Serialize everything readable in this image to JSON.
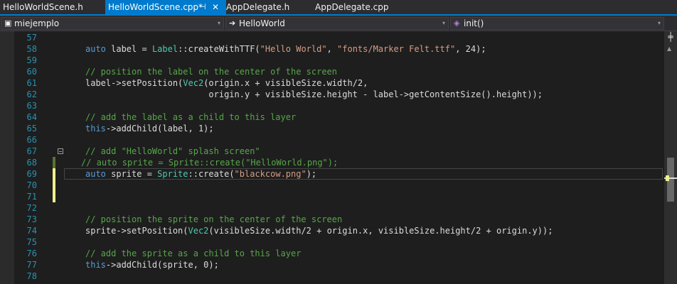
{
  "tabs": [
    {
      "label": "HelloWorldScene.h",
      "active": false
    },
    {
      "label": "HelloWorldScene.cpp*",
      "active": true
    },
    {
      "label": "AppDelegate.h",
      "active": false
    },
    {
      "label": "AppDelegate.cpp",
      "active": false
    }
  ],
  "icons": {
    "pin": "⊣",
    "close": "✕",
    "dropdown": "▾"
  },
  "navigation": {
    "project": "miejemplo",
    "scope": "HelloWorld",
    "member": "init()"
  },
  "code_lines": [
    {
      "num": "57",
      "tokens": []
    },
    {
      "num": "58",
      "tokens": [
        [
          "kw",
          "auto"
        ],
        [
          "pl",
          " label = "
        ],
        [
          "ty",
          "Label"
        ],
        [
          "pl",
          "::createWithTTF("
        ],
        [
          "str",
          "\"Hello World\""
        ],
        [
          "pl",
          ", "
        ],
        [
          "str",
          "\"fonts/Marker Felt.ttf\""
        ],
        [
          "pl",
          ", 24);"
        ]
      ]
    },
    {
      "num": "59",
      "tokens": []
    },
    {
      "num": "60",
      "tokens": [
        [
          "cm",
          "// position the label on the center of the screen"
        ]
      ]
    },
    {
      "num": "61",
      "tokens": [
        [
          "pl",
          "label->setPosition("
        ],
        [
          "ty",
          "Vec2"
        ],
        [
          "pl",
          "(origin.x + visibleSize.width/2,"
        ]
      ]
    },
    {
      "num": "62",
      "tokens": [
        [
          "pl",
          "                        origin.y + visibleSize.height - label->getContentSize().height));"
        ]
      ]
    },
    {
      "num": "63",
      "tokens": []
    },
    {
      "num": "64",
      "tokens": [
        [
          "cm",
          "// add the label as a child to this layer"
        ]
      ]
    },
    {
      "num": "65",
      "tokens": [
        [
          "kw",
          "this"
        ],
        [
          "pl",
          "->addChild(label, 1);"
        ]
      ]
    },
    {
      "num": "66",
      "tokens": []
    },
    {
      "num": "67",
      "tokens": [
        [
          "cm",
          "// add \"HelloWorld\" splash screen\""
        ]
      ]
    },
    {
      "num": "68",
      "tokens": [
        [
          "cm",
          "// auto sprite = Sprite::create(\"HelloWorld.png\");"
        ]
      ]
    },
    {
      "num": "69",
      "tokens": [
        [
          "kw",
          "auto"
        ],
        [
          "pl",
          " sprite = "
        ],
        [
          "ty",
          "Sprite"
        ],
        [
          "pl",
          "::create("
        ],
        [
          "str",
          "\"blackcow.png\""
        ],
        [
          "pl",
          ");"
        ]
      ]
    },
    {
      "num": "70",
      "tokens": []
    },
    {
      "num": "71",
      "tokens": []
    },
    {
      "num": "72",
      "tokens": []
    },
    {
      "num": "73",
      "tokens": [
        [
          "cm",
          "// position the sprite on the center of the screen"
        ]
      ]
    },
    {
      "num": "74",
      "tokens": [
        [
          "pl",
          "sprite->setPosition("
        ],
        [
          "ty",
          "Vec2"
        ],
        [
          "pl",
          "(visibleSize.width/2 + origin.x, visibleSize.height/2 + origin.y));"
        ]
      ]
    },
    {
      "num": "75",
      "tokens": []
    },
    {
      "num": "76",
      "tokens": [
        [
          "cm",
          "// add the sprite as a child to this layer"
        ]
      ]
    },
    {
      "num": "77",
      "tokens": [
        [
          "kw",
          "this"
        ],
        [
          "pl",
          "->addChild(sprite, 0);"
        ]
      ]
    },
    {
      "num": "78",
      "tokens": []
    }
  ],
  "colors": {
    "keyword": "#569cd6",
    "type": "#4ec9b0",
    "string": "#d69d85",
    "comment": "#57a64a",
    "line_number": "#2b91af",
    "accent": "#007acc"
  }
}
